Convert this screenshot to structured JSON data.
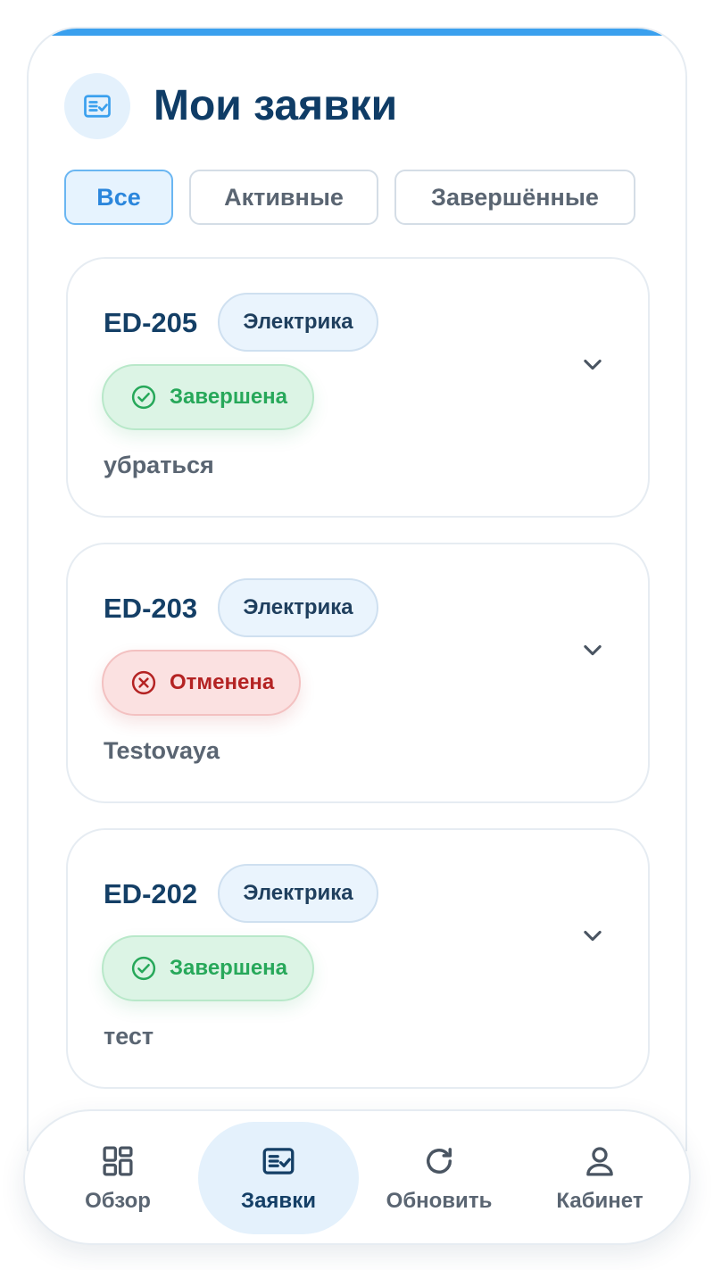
{
  "header": {
    "title": "Мои заявки",
    "icon": "checklist-icon",
    "accent_color": "#3aa0ee"
  },
  "filters": [
    {
      "label": "Все",
      "active": true
    },
    {
      "label": "Активные",
      "active": false
    },
    {
      "label": "Завершённые",
      "active": false
    }
  ],
  "requests": [
    {
      "id": "ED-205",
      "category": "Электрика",
      "status": "Завершена",
      "status_type": "done",
      "description": "убраться"
    },
    {
      "id": "ED-203",
      "category": "Электрика",
      "status": "Отменена",
      "status_type": "cancelled",
      "description": "Testovaya"
    },
    {
      "id": "ED-202",
      "category": "Электрика",
      "status": "Завершена",
      "status_type": "done",
      "description": "тест"
    }
  ],
  "status_colors": {
    "done": "#27a85a",
    "cancelled": "#b42323"
  },
  "bottom_nav": [
    {
      "label": "Обзор",
      "icon": "dashboard-icon",
      "active": false
    },
    {
      "label": "Заявки",
      "icon": "checklist-icon",
      "active": true
    },
    {
      "label": "Обновить",
      "icon": "refresh-icon",
      "active": false
    },
    {
      "label": "Кабинет",
      "icon": "user-icon",
      "active": false
    }
  ]
}
